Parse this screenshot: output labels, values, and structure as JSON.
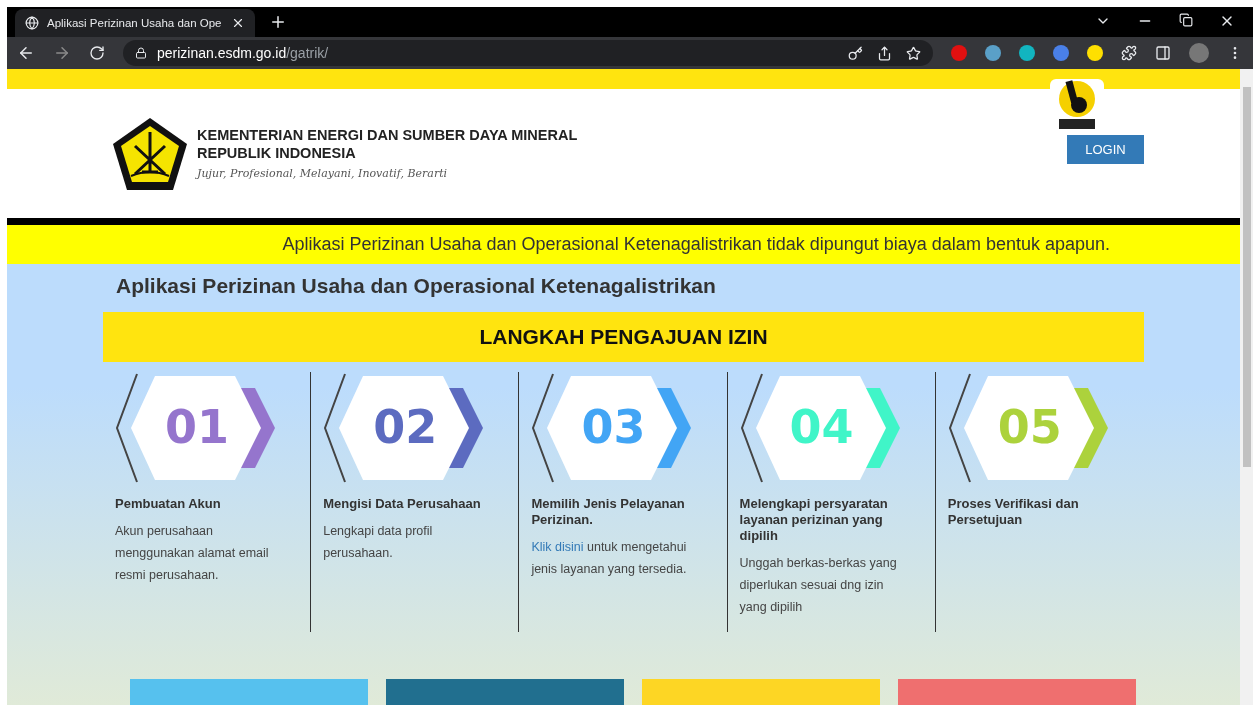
{
  "browser": {
    "tab_title": "Aplikasi Perizinan Usaha dan Ope",
    "url_host": "perizinan.esdm.go.id",
    "url_path": "/gatrik/"
  },
  "header": {
    "ministry": "KEMENTERIAN ENERGI DAN SUMBER DAYA MINERAL",
    "country": "REPUBLIK INDONESIA",
    "motto": "Jujur, Profesional, Melayani, Inovatif, Berarti",
    "login": "LOGIN"
  },
  "notice": "Aplikasi Perizinan Usaha dan Operasional Ketenagalistrikan tidak dipungut biaya dalam bentuk apapun.",
  "page_title": "Aplikasi Perizinan Usaha dan Operasional Ketenagalistrikan",
  "section_heading": "LANGKAH PENGAJUAN IZIN",
  "steps": [
    {
      "number": "01",
      "color": "#9575cd",
      "title": "Pembuatan Akun",
      "description": "Akun perusahaan menggunakan alamat email resmi perusahaan."
    },
    {
      "number": "02",
      "color": "#5c6bc0",
      "title": "Mengisi Data Perusahaan",
      "description": "Lengkapi data profil perusahaan."
    },
    {
      "number": "03",
      "color": "#42a5f5",
      "title": "Memilih Jenis Pelayanan Perizinan.",
      "link": "Klik disini",
      "description": "untuk mengetahui jenis layanan yang tersedia."
    },
    {
      "number": "04",
      "color": "#40f5c8",
      "title": "Melengkapi persyaratan layanan perizinan yang dipilih",
      "description": "Unggah berkas-berkas yang diperlukan sesuai dng izin yang dipilih"
    },
    {
      "number": "05",
      "color": "#acd23c",
      "title": "Proses Verifikasi dan Persetujuan"
    }
  ],
  "blocks": [
    {
      "color": "#56c1ee"
    },
    {
      "color": "#216f8f"
    },
    {
      "color": "#fdd624"
    },
    {
      "color": "#ef6f6f"
    }
  ]
}
